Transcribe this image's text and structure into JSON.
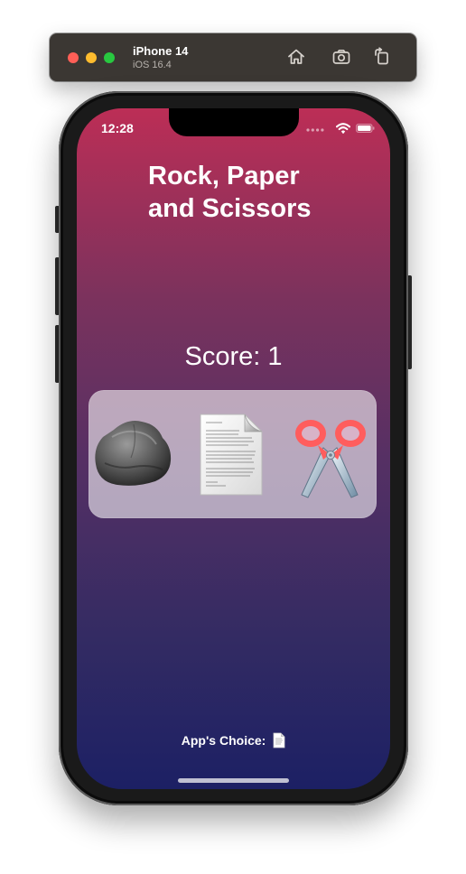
{
  "simulator": {
    "device_name": "iPhone 14",
    "os_version": "iOS 16.4",
    "toolbar_icons": [
      "home-icon",
      "screenshot-icon",
      "rotate-icon"
    ]
  },
  "status_bar": {
    "time": "12:28",
    "icons": [
      "signal-dots-icon",
      "wifi-icon",
      "battery-icon"
    ]
  },
  "app": {
    "title": "Rock, Paper\nand Scissors",
    "score_text": "Score: 1",
    "choices": [
      {
        "id": "rock",
        "icon": "rock-icon"
      },
      {
        "id": "paper",
        "icon": "paper-icon"
      },
      {
        "id": "scissors",
        "icon": "scissors-icon"
      }
    ],
    "app_choice_label": "App's Choice:",
    "app_choice_icon": "paper-icon"
  },
  "colors": {
    "gradient_top": "#bc2e56",
    "gradient_bottom": "#1c2064",
    "choice_panel": "rgba(255,255,255,0.58)",
    "text": "#ffffff"
  }
}
